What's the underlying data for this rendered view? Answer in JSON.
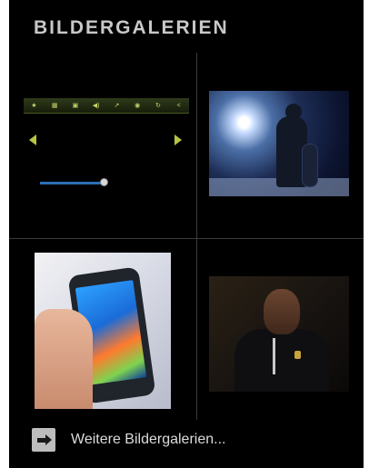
{
  "widget": {
    "title": "BILDERGALERIEN",
    "more_link_label": "Weitere Bildergalerien..."
  },
  "player": {
    "toolbar_items": [
      {
        "icon": "star-icon",
        "glyph": "★"
      },
      {
        "icon": "grid-icon",
        "glyph": "▦"
      },
      {
        "icon": "lock-icon",
        "glyph": "▣"
      },
      {
        "icon": "speaker-icon",
        "glyph": "◀)"
      },
      {
        "icon": "link-icon",
        "glyph": "↗"
      },
      {
        "icon": "camera-icon",
        "glyph": "◉"
      },
      {
        "icon": "refresh-icon",
        "glyph": "↻"
      },
      {
        "icon": "share-icon",
        "glyph": "<"
      }
    ]
  },
  "colors": {
    "background": "#000000",
    "title": "#c8c8c8",
    "accent_green": "#b6c444",
    "seek_blue": "#2a6fb7",
    "link_text": "#dcdcdc"
  }
}
